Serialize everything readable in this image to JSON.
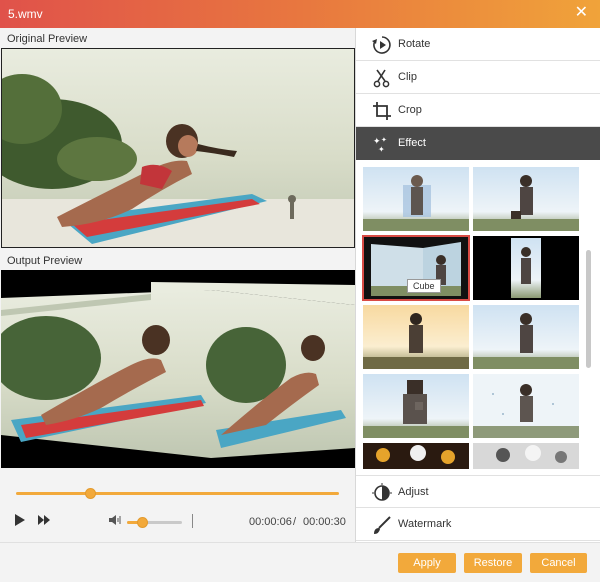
{
  "window": {
    "title": "5.wmv",
    "close_icon": "close-icon"
  },
  "left": {
    "original_label": "Original Preview",
    "output_label": "Output Preview",
    "playback": {
      "progress_fraction": 0.23,
      "volume_fraction": 0.28,
      "current_time": "00:00:06",
      "separator": "/",
      "total_time": "00:00:30"
    }
  },
  "right": {
    "menu": [
      {
        "label": "Rotate",
        "icon": "rotate-icon"
      },
      {
        "label": "Clip",
        "icon": "scissors-icon"
      },
      {
        "label": "Crop",
        "icon": "crop-icon"
      },
      {
        "label": "Effect",
        "icon": "effect-icon",
        "active": true
      }
    ],
    "effects": {
      "tooltip": "Cube",
      "selected": "Cube"
    },
    "bottom_menu": [
      {
        "label": "Adjust",
        "icon": "adjust-icon"
      },
      {
        "label": "Watermark",
        "icon": "brush-icon"
      }
    ]
  },
  "footer": {
    "apply": "Apply",
    "restore": "Restore",
    "cancel": "Cancel"
  },
  "colors": {
    "accent": "#f2a93b",
    "title_start": "#e0524a",
    "title_end": "#f0a33a",
    "active_menu": "#4a4a4a",
    "selection": "#d94b45"
  }
}
